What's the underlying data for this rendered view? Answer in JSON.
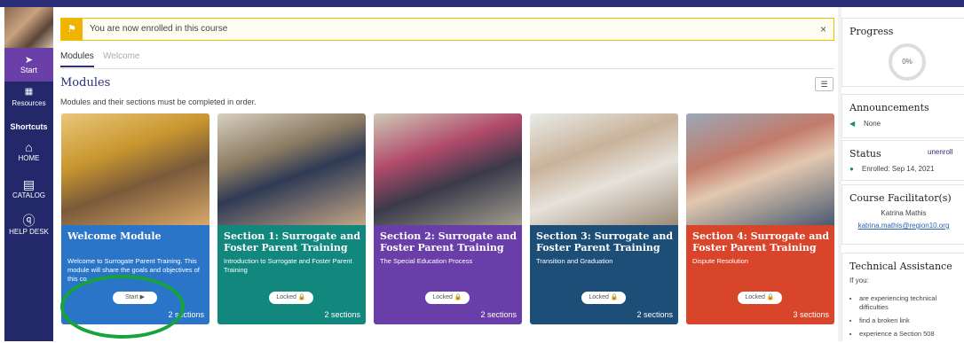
{
  "banner": {
    "text": "You are now enrolled in this course",
    "close": "×"
  },
  "sidebar": {
    "start": "Start",
    "resources": "Resources",
    "shortcuts": "Shortcuts",
    "home": "HOME",
    "catalog": "CATALOG",
    "helpdesk": "HELP DESK"
  },
  "tabs": [
    {
      "label": "Modules"
    },
    {
      "label": "Welcome"
    }
  ],
  "main": {
    "title": "Modules",
    "subtitle": "Modules and their sections must be completed in order."
  },
  "cards": [
    {
      "title": "Welcome Module",
      "desc": "Welcome to Surrogate Parent Training. This module will share the goals and objectives of this co...",
      "button": "Start ▶",
      "count": "2 sections",
      "color": "#2b75c9"
    },
    {
      "title": "Section 1: Surrogate and Foster Parent Training",
      "desc": "Introduction to Surrogate and Foster Parent Training",
      "button": "Locked 🔒",
      "count": "2 sections",
      "color": "#12877e"
    },
    {
      "title": "Section 2: Surrogate and Foster Parent Training",
      "desc": "The Special Education Process",
      "button": "Locked 🔒",
      "count": "2 sections",
      "color": "#6a3ea8"
    },
    {
      "title": "Section 3: Surrogate and Foster Parent Training",
      "desc": "Transition and Graduation",
      "button": "Locked 🔒",
      "count": "2 sections",
      "color": "#1d4e78"
    },
    {
      "title": "Section 4: Surrogate and Foster Parent Training",
      "desc": "Dispute Resolution",
      "button": "Locked 🔒",
      "count": "3 sections",
      "color": "#d9452b"
    }
  ],
  "progress": {
    "title": "Progress",
    "value": "0%"
  },
  "announcements": {
    "title": "Announcements",
    "text": "None"
  },
  "status": {
    "title": "Status",
    "link": "unenroll",
    "text": "Enrolled: Sep 14, 2021"
  },
  "facilitator": {
    "title": "Course Facilitator(s)",
    "name": "Katrina Mathis",
    "email": "katrina.mathis@region10.org"
  },
  "technical": {
    "title": "Technical Assistance",
    "intro": "If you:",
    "items": [
      "are experiencing technical difficulties",
      "find a broken link",
      "experience a Section 508"
    ]
  },
  "colors": {
    "nav": "#23286b",
    "accent": "#6b3fa8",
    "ring": "#15a33a"
  }
}
